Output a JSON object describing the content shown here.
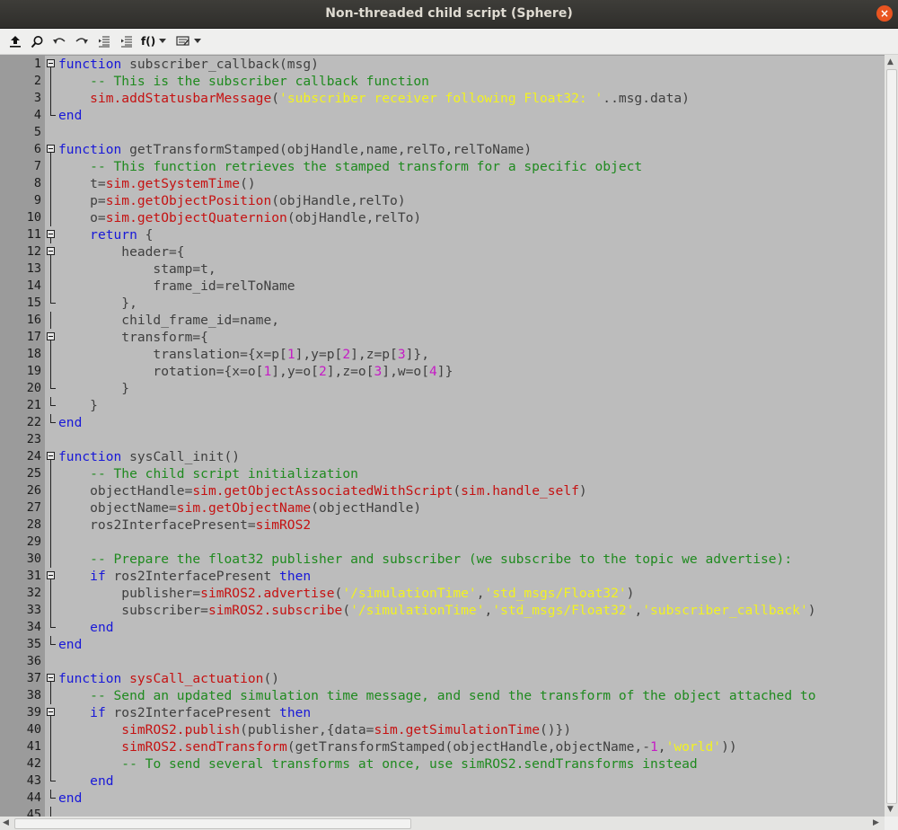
{
  "window": {
    "title": "Non-threaded child script (Sphere)"
  },
  "toolbar": {
    "functions_label": "f()"
  },
  "icons": [
    "upload-icon",
    "search-icon",
    "undo-icon",
    "redo-icon",
    "unindent-icon",
    "indent-icon",
    "functions-dropdown-icon",
    "snippets-dropdown-icon"
  ],
  "colors": {
    "keyword": "#1818d8",
    "comment": "#1f8a1f",
    "string": "#f2f221",
    "builtin": "#c51212",
    "number": "#c51bc5",
    "editor_bg": "#bcbcbc",
    "gutter_bg": "#9b9b9b"
  },
  "lines": [
    {
      "n": "1",
      "fold": "open",
      "t": [
        [
          "kw",
          "function"
        ],
        [
          "tx",
          " subscriber_callback(msg)"
        ]
      ]
    },
    {
      "n": "2",
      "fold": "line",
      "t": [
        [
          "tx",
          "    "
        ],
        [
          "cm",
          "-- This is the subscriber callback function"
        ]
      ]
    },
    {
      "n": "3",
      "fold": "line",
      "t": [
        [
          "tx",
          "    "
        ],
        [
          "fn",
          "sim.addStatusbarMessage"
        ],
        [
          "tx",
          "("
        ],
        [
          "st",
          "'subscriber receiver following Float32: '"
        ],
        [
          "tx",
          "..msg.data)"
        ]
      ]
    },
    {
      "n": "4",
      "fold": "end",
      "t": [
        [
          "kw",
          "end"
        ]
      ]
    },
    {
      "n": "5",
      "fold": "none",
      "t": []
    },
    {
      "n": "6",
      "fold": "open",
      "t": [
        [
          "kw",
          "function"
        ],
        [
          "tx",
          " getTransformStamped(objHandle,name,relTo,relToName)"
        ]
      ]
    },
    {
      "n": "7",
      "fold": "line",
      "t": [
        [
          "tx",
          "    "
        ],
        [
          "cm",
          "-- This function retrieves the stamped transform for a specific object"
        ]
      ]
    },
    {
      "n": "8",
      "fold": "line",
      "t": [
        [
          "tx",
          "    t="
        ],
        [
          "fn",
          "sim.getSystemTime"
        ],
        [
          "tx",
          "()"
        ]
      ]
    },
    {
      "n": "9",
      "fold": "line",
      "t": [
        [
          "tx",
          "    p="
        ],
        [
          "fn",
          "sim.getObjectPosition"
        ],
        [
          "tx",
          "(objHandle,relTo)"
        ]
      ]
    },
    {
      "n": "10",
      "fold": "line",
      "t": [
        [
          "tx",
          "    o="
        ],
        [
          "fn",
          "sim.getObjectQuaternion"
        ],
        [
          "tx",
          "(objHandle,relTo)"
        ]
      ]
    },
    {
      "n": "11",
      "fold": "open",
      "t": [
        [
          "tx",
          "    "
        ],
        [
          "kw",
          "return"
        ],
        [
          "tx",
          " {"
        ]
      ]
    },
    {
      "n": "12",
      "fold": "open",
      "t": [
        [
          "tx",
          "        header={"
        ]
      ]
    },
    {
      "n": "13",
      "fold": "line",
      "t": [
        [
          "tx",
          "            stamp=t,"
        ]
      ]
    },
    {
      "n": "14",
      "fold": "line",
      "t": [
        [
          "tx",
          "            frame_id=relToName"
        ]
      ]
    },
    {
      "n": "15",
      "fold": "end",
      "t": [
        [
          "tx",
          "        },"
        ]
      ]
    },
    {
      "n": "16",
      "fold": "line",
      "t": [
        [
          "tx",
          "        child_frame_id=name,"
        ]
      ]
    },
    {
      "n": "17",
      "fold": "open",
      "t": [
        [
          "tx",
          "        transform={"
        ]
      ]
    },
    {
      "n": "18",
      "fold": "line",
      "t": [
        [
          "tx",
          "            translation={x=p["
        ],
        [
          "nm",
          "1"
        ],
        [
          "tx",
          "],y=p["
        ],
        [
          "nm",
          "2"
        ],
        [
          "tx",
          "],z=p["
        ],
        [
          "nm",
          "3"
        ],
        [
          "tx",
          "]},"
        ]
      ]
    },
    {
      "n": "19",
      "fold": "line",
      "t": [
        [
          "tx",
          "            rotation={x=o["
        ],
        [
          "nm",
          "1"
        ],
        [
          "tx",
          "],y=o["
        ],
        [
          "nm",
          "2"
        ],
        [
          "tx",
          "],z=o["
        ],
        [
          "nm",
          "3"
        ],
        [
          "tx",
          "],w=o["
        ],
        [
          "nm",
          "4"
        ],
        [
          "tx",
          "]}"
        ]
      ]
    },
    {
      "n": "20",
      "fold": "end",
      "t": [
        [
          "tx",
          "        }"
        ]
      ]
    },
    {
      "n": "21",
      "fold": "end",
      "t": [
        [
          "tx",
          "    }"
        ]
      ]
    },
    {
      "n": "22",
      "fold": "end",
      "t": [
        [
          "kw",
          "end"
        ]
      ]
    },
    {
      "n": "23",
      "fold": "none",
      "t": []
    },
    {
      "n": "24",
      "fold": "open",
      "t": [
        [
          "kw",
          "function"
        ],
        [
          "tx",
          " sysCall_init()"
        ]
      ]
    },
    {
      "n": "25",
      "fold": "line",
      "t": [
        [
          "tx",
          "    "
        ],
        [
          "cm",
          "-- The child script initialization"
        ]
      ]
    },
    {
      "n": "26",
      "fold": "line",
      "t": [
        [
          "tx",
          "    objectHandle="
        ],
        [
          "fn",
          "sim.getObjectAssociatedWithScript"
        ],
        [
          "tx",
          "("
        ],
        [
          "fn",
          "sim.handle_self"
        ],
        [
          "tx",
          ")"
        ]
      ]
    },
    {
      "n": "27",
      "fold": "line",
      "t": [
        [
          "tx",
          "    objectName="
        ],
        [
          "fn",
          "sim.getObjectName"
        ],
        [
          "tx",
          "(objectHandle)"
        ]
      ]
    },
    {
      "n": "28",
      "fold": "line",
      "t": [
        [
          "tx",
          "    ros2InterfacePresent="
        ],
        [
          "fn",
          "simROS2"
        ]
      ]
    },
    {
      "n": "29",
      "fold": "line",
      "t": []
    },
    {
      "n": "30",
      "fold": "line",
      "t": [
        [
          "tx",
          "    "
        ],
        [
          "cm",
          "-- Prepare the float32 publisher and subscriber (we subscribe to the topic we advertise):"
        ]
      ]
    },
    {
      "n": "31",
      "fold": "open",
      "t": [
        [
          "tx",
          "    "
        ],
        [
          "kw",
          "if"
        ],
        [
          "tx",
          " ros2InterfacePresent "
        ],
        [
          "kw",
          "then"
        ]
      ]
    },
    {
      "n": "32",
      "fold": "line",
      "t": [
        [
          "tx",
          "        publisher="
        ],
        [
          "fn",
          "simROS2.advertise"
        ],
        [
          "tx",
          "("
        ],
        [
          "st",
          "'/simulationTime'"
        ],
        [
          "tx",
          ","
        ],
        [
          "st",
          "'std_msgs/Float32'"
        ],
        [
          "tx",
          ")"
        ]
      ]
    },
    {
      "n": "33",
      "fold": "line",
      "t": [
        [
          "tx",
          "        subscriber="
        ],
        [
          "fn",
          "simROS2.subscribe"
        ],
        [
          "tx",
          "("
        ],
        [
          "st",
          "'/simulationTime'"
        ],
        [
          "tx",
          ","
        ],
        [
          "st",
          "'std_msgs/Float32'"
        ],
        [
          "tx",
          ","
        ],
        [
          "st",
          "'subscriber_callback'"
        ],
        [
          "tx",
          ")"
        ]
      ]
    },
    {
      "n": "34",
      "fold": "end",
      "t": [
        [
          "tx",
          "    "
        ],
        [
          "kw",
          "end"
        ]
      ]
    },
    {
      "n": "35",
      "fold": "end",
      "t": [
        [
          "kw",
          "end"
        ]
      ]
    },
    {
      "n": "36",
      "fold": "none",
      "t": []
    },
    {
      "n": "37",
      "fold": "open",
      "t": [
        [
          "kw",
          "function"
        ],
        [
          "tx",
          " "
        ],
        [
          "fn",
          "sysCall_actuation"
        ],
        [
          "tx",
          "()"
        ]
      ]
    },
    {
      "n": "38",
      "fold": "line",
      "t": [
        [
          "tx",
          "    "
        ],
        [
          "cm",
          "-- Send an updated simulation time message, and send the transform of the object attached to"
        ]
      ]
    },
    {
      "n": "39",
      "fold": "open",
      "t": [
        [
          "tx",
          "    "
        ],
        [
          "kw",
          "if"
        ],
        [
          "tx",
          " ros2InterfacePresent "
        ],
        [
          "kw",
          "then"
        ]
      ]
    },
    {
      "n": "40",
      "fold": "line",
      "t": [
        [
          "tx",
          "        "
        ],
        [
          "fn",
          "simROS2.publish"
        ],
        [
          "tx",
          "(publisher,{data="
        ],
        [
          "fn",
          "sim.getSimulationTime"
        ],
        [
          "tx",
          "()})"
        ]
      ]
    },
    {
      "n": "41",
      "fold": "line",
      "t": [
        [
          "tx",
          "        "
        ],
        [
          "fn",
          "simROS2.sendTransform"
        ],
        [
          "tx",
          "(getTransformStamped(objectHandle,objectName,-"
        ],
        [
          "nm",
          "1"
        ],
        [
          "tx",
          ","
        ],
        [
          "st",
          "'world'"
        ],
        [
          "tx",
          "))"
        ]
      ]
    },
    {
      "n": "42",
      "fold": "line",
      "t": [
        [
          "tx",
          "        "
        ],
        [
          "cm",
          "-- To send several transforms at once, use simROS2.sendTransforms instead"
        ]
      ]
    },
    {
      "n": "43",
      "fold": "end",
      "t": [
        [
          "tx",
          "    "
        ],
        [
          "kw",
          "end"
        ]
      ]
    },
    {
      "n": "44",
      "fold": "end",
      "t": [
        [
          "kw",
          "end"
        ]
      ]
    },
    {
      "n": "45",
      "fold": "line",
      "t": []
    }
  ]
}
